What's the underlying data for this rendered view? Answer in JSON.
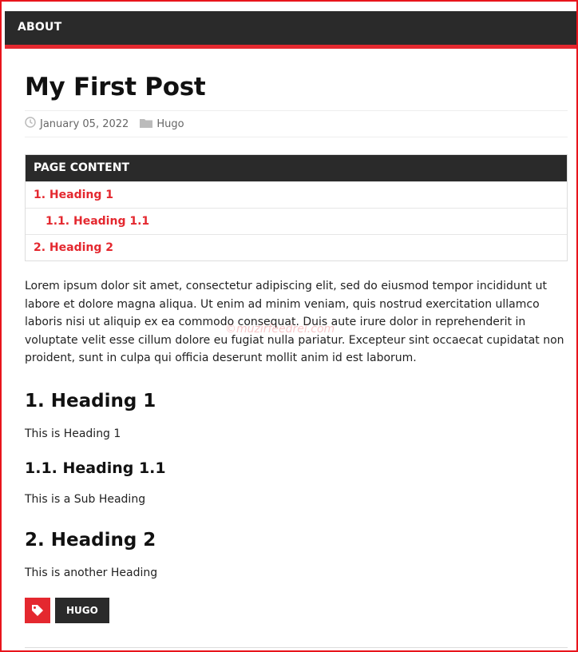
{
  "nav": {
    "about_label": "ABOUT"
  },
  "post": {
    "title": "My First Post",
    "date": "January 05, 2022",
    "category": "Hugo"
  },
  "toc": {
    "heading": "PAGE CONTENT",
    "items": [
      {
        "label": "1. Heading 1"
      },
      {
        "label": "1.1. Heading 1.1"
      },
      {
        "label": "2. Heading 2"
      }
    ]
  },
  "content": {
    "intro": "Lorem ipsum dolor sit amet, consectetur adipiscing elit, sed do eiusmod tempor incididunt ut labore et dolore magna aliqua. Ut enim ad minim veniam, quis nostrud exercitation ullamco laboris nisi ut aliquip ex ea commodo consequat. Duis aute irure dolor in reprehenderit in voluptate velit esse cillum dolore eu fugiat nulla pariatur. Excepteur sint occaecat cupidatat non proident, sunt in culpa qui officia deserunt mollit anim id est laborum.",
    "watermark": "©muzirfeedrei.com",
    "h1": "1. Heading 1",
    "h1_text": "This is Heading 1",
    "h11": "1.1. Heading 1.1",
    "h11_text": "This is a Sub Heading",
    "h2": "2. Heading 2",
    "h2_text": "This is another Heading"
  },
  "tags": [
    {
      "label": "HUGO"
    }
  ],
  "colors": {
    "accent": "#e4282f",
    "dark": "#2a2a2a"
  },
  "icons": {
    "date": "clock-icon",
    "category": "folder-icon",
    "tags": "tag-icon"
  }
}
